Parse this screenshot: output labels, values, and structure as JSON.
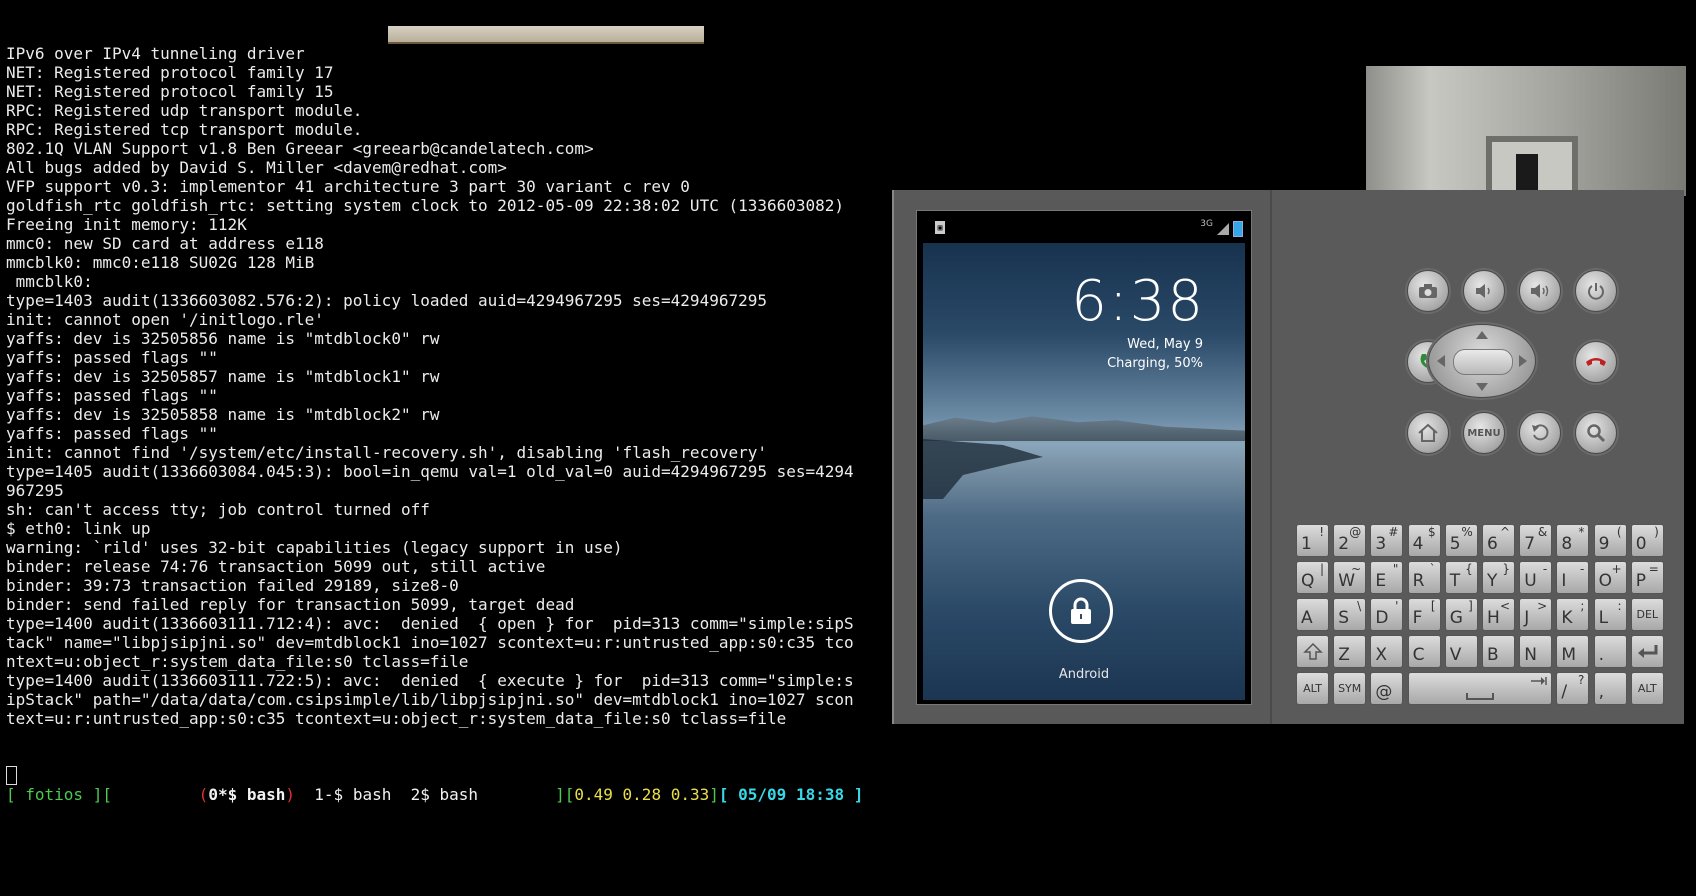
{
  "terminal": {
    "lines": [
      "IPv6 over IPv4 tunneling driver",
      "NET: Registered protocol family 17",
      "NET: Registered protocol family 15",
      "RPC: Registered udp transport module.",
      "RPC: Registered tcp transport module.",
      "802.1Q VLAN Support v1.8 Ben Greear <greearb@candelatech.com>",
      "All bugs added by David S. Miller <davem@redhat.com>",
      "VFP support v0.3: implementor 41 architecture 3 part 30 variant c rev 0",
      "goldfish_rtc goldfish_rtc: setting system clock to 2012-05-09 22:38:02 UTC (1336603082)",
      "Freeing init memory: 112K",
      "mmc0: new SD card at address e118",
      "mmcblk0: mmc0:e118 SU02G 128 MiB",
      " mmcblk0:",
      "type=1403 audit(1336603082.576:2): policy loaded auid=4294967295 ses=4294967295",
      "init: cannot open '/initlogo.rle'",
      "yaffs: dev is 32505856 name is \"mtdblock0\" rw",
      "yaffs: passed flags \"\"",
      "yaffs: dev is 32505857 name is \"mtdblock1\" rw",
      "yaffs: passed flags \"\"",
      "yaffs: dev is 32505858 name is \"mtdblock2\" rw",
      "yaffs: passed flags \"\"",
      "init: cannot find '/system/etc/install-recovery.sh', disabling 'flash_recovery'",
      "type=1405 audit(1336603084.045:3): bool=in_qemu val=1 old_val=0 auid=4294967295 ses=4294",
      "967295",
      "sh: can't access tty; job control turned off",
      "$ eth0: link up",
      "warning: `rild' uses 32-bit capabilities (legacy support in use)",
      "binder: release 74:76 transaction 5099 out, still active",
      "binder: 39:73 transaction failed 29189, size8-0",
      "binder: send failed reply for transaction 5099, target dead",
      "type=1400 audit(1336603111.712:4): avc:  denied  { open } for  pid=313 comm=\"simple:sipS",
      "tack\" name=\"libpjsipjni.so\" dev=mtdblock1 ino=1027 scontext=u:r:untrusted_app:s0:c35 tco",
      "ntext=u:object_r:system_data_file:s0 tclass=file",
      "type=1400 audit(1336603111.722:5): avc:  denied  { execute } for  pid=313 comm=\"simple:s",
      "ipStack\" path=\"/data/data/com.csipsimple/lib/libpjsipjni.so\" dev=mtdblock1 ino=1027 scon",
      "text=u:r:untrusted_app:s0:c35 tcontext=u:object_r:system_data_file:s0 tclass=file"
    ]
  },
  "screen_status": {
    "open": "[ ",
    "host": "fotios",
    "mid": " ][",
    "gap": "         ",
    "lp": "(",
    "active_window": "0*$ bash",
    "rp": ")",
    "windows": "  1-$ bash  2$ bash        ",
    "lb": "][",
    "load": "0.49 0.28 0.33",
    "rb": "]",
    "datetime": "[ 05/09 18:38 ]"
  },
  "emulator": {
    "status_bar": {
      "network": "3G",
      "sd_icon": "sd-card-icon",
      "battery_color": "#35a7e8"
    },
    "lockscreen": {
      "time": "6:38",
      "date": "Wed, May 9",
      "charging": "Charging, 50%",
      "carrier": "Android",
      "unlock_icon": "padlock-icon"
    },
    "buttons": {
      "camera": "camera-icon",
      "vol_down": "volume-down-icon",
      "vol_up": "volume-up-icon",
      "power": "power-icon",
      "call": "call-icon",
      "end_call": "end-call-icon",
      "home": "home-icon",
      "menu_label": "MENU",
      "back": "back-icon",
      "search": "search-icon",
      "call_color": "#2e8b3a",
      "end_color": "#c02020"
    },
    "keyboard": {
      "row1": [
        [
          "1",
          "!"
        ],
        [
          "2",
          "@"
        ],
        [
          "3",
          "#"
        ],
        [
          "4",
          "$"
        ],
        [
          "5",
          "%"
        ],
        [
          "6",
          "^"
        ],
        [
          "7",
          "&"
        ],
        [
          "8",
          "*"
        ],
        [
          "9",
          "("
        ],
        [
          "0",
          ")"
        ]
      ],
      "row2": [
        [
          "Q",
          "|"
        ],
        [
          "W",
          "~"
        ],
        [
          "E",
          "\""
        ],
        [
          "R",
          "`"
        ],
        [
          "T",
          "{"
        ],
        [
          "Y",
          "}"
        ],
        [
          "U",
          "-"
        ],
        [
          "I",
          "-"
        ],
        [
          "O",
          "+"
        ],
        [
          "P",
          "="
        ]
      ],
      "row3": [
        [
          "A",
          ""
        ],
        [
          "S",
          "\\"
        ],
        [
          "D",
          "'"
        ],
        [
          "F",
          "["
        ],
        [
          "G",
          "]"
        ],
        [
          "H",
          "<"
        ],
        [
          "J",
          ">"
        ],
        [
          "K",
          ";"
        ],
        [
          "L",
          ":"
        ]
      ],
      "row4": [
        [
          "Z",
          ""
        ],
        [
          "X",
          ""
        ],
        [
          "C",
          ""
        ],
        [
          "V",
          ""
        ],
        [
          "B",
          ""
        ],
        [
          "N",
          ""
        ],
        [
          "M",
          ""
        ],
        [
          ".",
          ""
        ]
      ],
      "del": "DEL",
      "alt": "ALT",
      "sym": "SYM",
      "at": "@",
      "slash": [
        "/",
        "?"
      ],
      "comma": ","
    }
  }
}
